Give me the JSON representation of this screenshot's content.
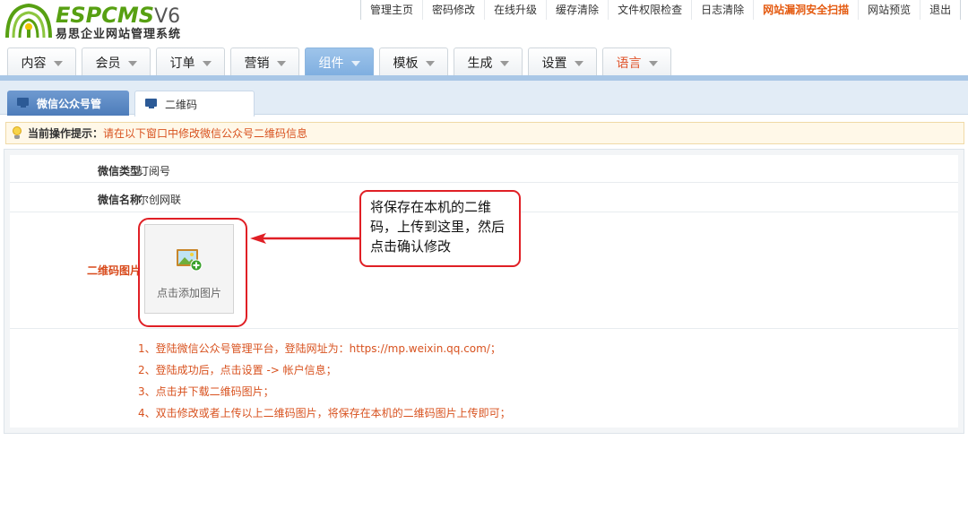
{
  "brand": {
    "logo_main": "ESPCMS",
    "logo_version": "V6",
    "logo_subtitle": "易思企业网站管理系统",
    "colors": {
      "green": "#57a012",
      "accent_orange": "#e45a10",
      "nav_active": "#8ab4e2",
      "callout_red": "#e01f25"
    }
  },
  "topnav": [
    {
      "label": "管理主页"
    },
    {
      "label": "密码修改"
    },
    {
      "label": "在线升级"
    },
    {
      "label": "缓存清除"
    },
    {
      "label": "文件权限检查"
    },
    {
      "label": "日志清除"
    },
    {
      "label": "网站漏洞安全扫描",
      "highlight": true
    },
    {
      "label": "网站预览"
    },
    {
      "label": "退出"
    }
  ],
  "mainnav": [
    {
      "label": "内容"
    },
    {
      "label": "会员"
    },
    {
      "label": "订单"
    },
    {
      "label": "营销"
    },
    {
      "label": "组件",
      "active": true
    },
    {
      "label": "模板"
    },
    {
      "label": "生成"
    },
    {
      "label": "设置"
    },
    {
      "label": "语言"
    }
  ],
  "tabs": [
    {
      "label": "微信公众号管",
      "active": false,
      "icon": "monitor-icon"
    },
    {
      "label": "二维码",
      "active": true,
      "icon": "monitor-icon"
    }
  ],
  "tip": {
    "label": "当前操作提示：",
    "message": "请在以下窗口中修改微信公众号二维码信息",
    "icon": "lightbulb-icon"
  },
  "form": {
    "type_label": "微信类型",
    "type_value": "订阅号",
    "name_label": "微信名称",
    "name_value": "尔创网联",
    "qrcode_label": "二维码图片",
    "upload_caption": "点击添加图片",
    "upload_icon": "add-image-icon"
  },
  "annotation": {
    "callout_text": "将保存在本机的二维码，上传到这里，然后点击确认修改"
  },
  "notes": [
    "1、登陆微信公众号管理平台，登陆网址为：https://mp.weixin.qq.com/；",
    "2、登陆成功后，点击设置 -> 帐户信息；",
    "3、点击并下载二维码图片；",
    "4、双击修改或者上传以上二维码图片，将保存在本机的二维码图片上传即可；"
  ]
}
